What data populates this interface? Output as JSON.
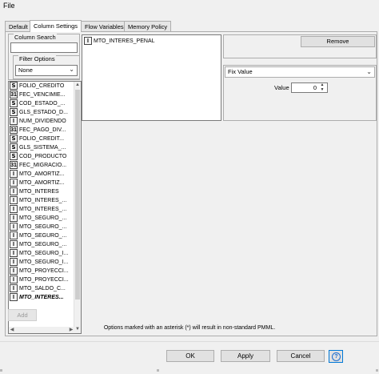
{
  "menu": {
    "file": "File"
  },
  "tabs": [
    {
      "label": "Default",
      "active": false
    },
    {
      "label": "Column Settings",
      "active": true
    },
    {
      "label": "Flow Variables",
      "active": false
    },
    {
      "label": "Memory Policy",
      "active": false
    }
  ],
  "column_search": {
    "label": "Column Search",
    "value": ""
  },
  "filter_options": {
    "label": "Filter Options",
    "selected": "None"
  },
  "columns": [
    {
      "type": "S",
      "name": "FOLIO_CREDITO",
      "bold": false
    },
    {
      "type": "D",
      "name": "FEC_VENCIMIE...",
      "bold": false
    },
    {
      "type": "S",
      "name": "COD_ESTADO_...",
      "bold": false
    },
    {
      "type": "S",
      "name": "GLS_ESTADO_D...",
      "bold": false
    },
    {
      "type": "I",
      "name": "NUM_DIVIDENDO",
      "bold": false
    },
    {
      "type": "D",
      "name": "FEC_PAGO_DIV...",
      "bold": false
    },
    {
      "type": "S",
      "name": "FOLIO_CREDIT...",
      "bold": false
    },
    {
      "type": "S",
      "name": "GLS_SISTEMA_...",
      "bold": false
    },
    {
      "type": "S",
      "name": "COD_PRODUCTO",
      "bold": false
    },
    {
      "type": "D",
      "name": "FEC_MIGRACIO...",
      "bold": false
    },
    {
      "type": "I",
      "name": "MTO_AMORTIZ...",
      "bold": false
    },
    {
      "type": "I",
      "name": "MTO_AMORTIZ...",
      "bold": false
    },
    {
      "type": "I",
      "name": "MTO_INTERES",
      "bold": false
    },
    {
      "type": "I",
      "name": "MTO_INTERES_...",
      "bold": false
    },
    {
      "type": "I",
      "name": "MTO_INTERES_...",
      "bold": false
    },
    {
      "type": "I",
      "name": "MTO_SEGURO_...",
      "bold": false
    },
    {
      "type": "I",
      "name": "MTO_SEGURO_...",
      "bold": false
    },
    {
      "type": "I",
      "name": "MTO_SEGURO_...",
      "bold": false
    },
    {
      "type": "I",
      "name": "MTO_SEGURO_...",
      "bold": false
    },
    {
      "type": "I",
      "name": "MTO_SEGURO_I...",
      "bold": false
    },
    {
      "type": "I",
      "name": "MTO_SEGURO_I...",
      "bold": false
    },
    {
      "type": "I",
      "name": "MTO_PROYECCI...",
      "bold": false
    },
    {
      "type": "I",
      "name": "MTO_PROYECCI...",
      "bold": false
    },
    {
      "type": "I",
      "name": "MTO_SALDO_C...",
      "bold": false
    },
    {
      "type": "I",
      "name": "MTO_INTERES...",
      "bold": true
    }
  ],
  "selected_columns": [
    {
      "type": "I",
      "name": "MTO_INTERES_PENAL"
    }
  ],
  "remove_label": "Remove",
  "missing_value": {
    "method": "Fix Value",
    "value_label": "Value",
    "value": "0"
  },
  "add_label": "Add",
  "note": "Options marked with an asterisk (*) will result in non-standard PMML.",
  "buttons": {
    "ok": "OK",
    "apply": "Apply",
    "cancel": "Cancel",
    "help": "?"
  },
  "colors": {
    "help_accent": "#1e6fd0",
    "focus_border": "#0078d7"
  }
}
